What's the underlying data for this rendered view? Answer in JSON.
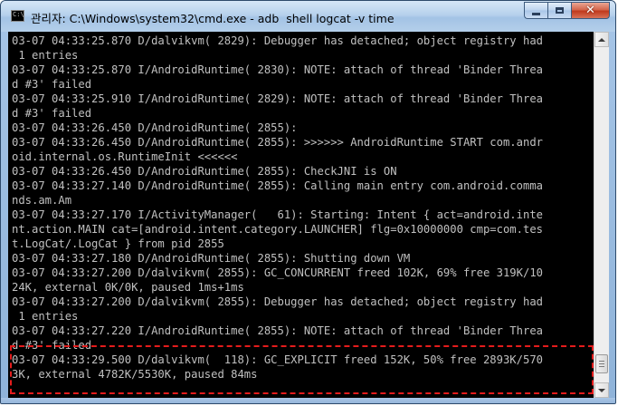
{
  "window": {
    "title": "관리자: C:\\Windows\\system32\\cmd.exe - adb  shell logcat -v time",
    "icon_label": "C:\\",
    "controls": {
      "minimize": "minimize-icon",
      "maximize": "maximize-icon",
      "close": "✕"
    }
  },
  "console": {
    "lines": [
      "03-07 04:33:25.870 D/dalvikvm( 2829): Debugger has detached; object registry had",
      " 1 entries",
      "03-07 04:33:25.870 I/AndroidRuntime( 2830): NOTE: attach of thread 'Binder Threa",
      "d #3' failed",
      "03-07 04:33:25.910 I/AndroidRuntime( 2829): NOTE: attach of thread 'Binder Threa",
      "d #3' failed",
      "03-07 04:33:26.450 D/AndroidRuntime( 2855):",
      "03-07 04:33:26.450 D/AndroidRuntime( 2855): >>>>>> AndroidRuntime START com.andr",
      "oid.internal.os.RuntimeInit <<<<<<",
      "03-07 04:33:26.450 D/AndroidRuntime( 2855): CheckJNI is ON",
      "03-07 04:33:27.140 D/AndroidRuntime( 2855): Calling main entry com.android.comma",
      "nds.am.Am",
      "03-07 04:33:27.170 I/ActivityManager(   61): Starting: Intent { act=android.inte",
      "nt.action.MAIN cat=[android.intent.category.LAUNCHER] flg=0x10000000 cmp=com.tes",
      "t.LogCat/.LogCat } from pid 2855",
      "03-07 04:33:27.180 D/AndroidRuntime( 2855): Shutting down VM",
      "03-07 04:33:27.200 D/dalvikvm( 2855): GC_CONCURRENT freed 102K, 69% free 319K/10",
      "24K, external 0K/0K, paused 1ms+1ms",
      "03-07 04:33:27.200 D/dalvikvm( 2855): Debugger has detached; object registry had",
      " 1 entries",
      "03-07 04:33:27.220 I/AndroidRuntime( 2855): NOTE: attach of thread 'Binder Threa",
      "d #3' failed",
      "03-07 04:33:29.500 D/dalvikvm(  118): GC_EXPLICIT freed 152K, 50% free 2893K/570",
      "3K, external 4782K/5530K, paused 84ms",
      ""
    ],
    "text_color": "#c0c0c0",
    "background": "#000000"
  },
  "annotation": {
    "highlight_color": "#e41c1c"
  },
  "scrollbar": {
    "thumb_position": 0.97
  }
}
